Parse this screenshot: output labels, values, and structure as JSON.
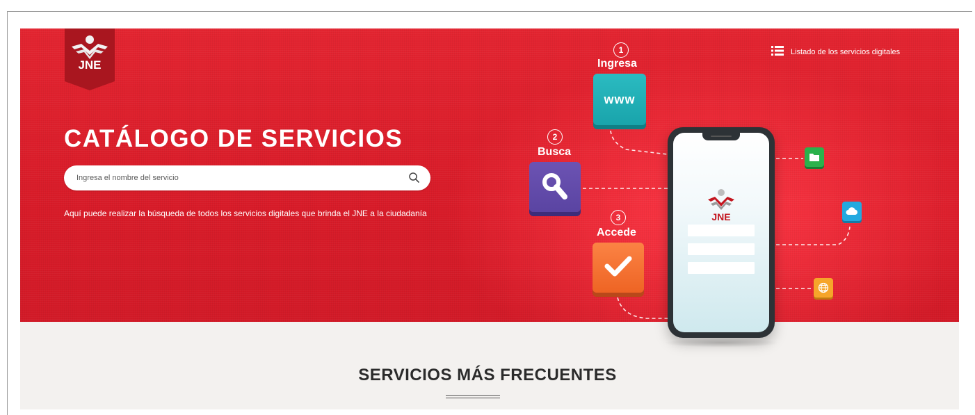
{
  "brand": {
    "logo_text": "JNE",
    "accent": "#d71f2b"
  },
  "header": {
    "list_link": "Listado de los servicios digitales",
    "list_icon": "list-icon"
  },
  "hero": {
    "title": "CATÁLOGO DE SERVICIOS",
    "search": {
      "placeholder": "Ingresa el nombre del servicio",
      "value": "",
      "icon": "search-icon"
    },
    "description": "Aquí puede realizar la búsqueda de todos los servicios digitales que brinda el JNE a la ciudadanía"
  },
  "steps": [
    {
      "number": "1",
      "label": "Ingresa",
      "tile_text": "www",
      "color": "#1fadb4"
    },
    {
      "number": "2",
      "label": "Busca",
      "icon": "magnifier-icon",
      "color": "#5f48a8"
    },
    {
      "number": "3",
      "label": "Accede",
      "icon": "checkmark-icon",
      "color": "#f2702e"
    }
  ],
  "phone": {
    "logo_text": "JNE"
  },
  "mini_icons": [
    {
      "name": "folder-icon",
      "color": "#2bb24c"
    },
    {
      "name": "cloud-icon",
      "color": "#23a9e0"
    },
    {
      "name": "globe-icon",
      "color": "#f6a52a"
    }
  ],
  "section": {
    "title": "SERVICIOS MÁS FRECUENTES"
  }
}
